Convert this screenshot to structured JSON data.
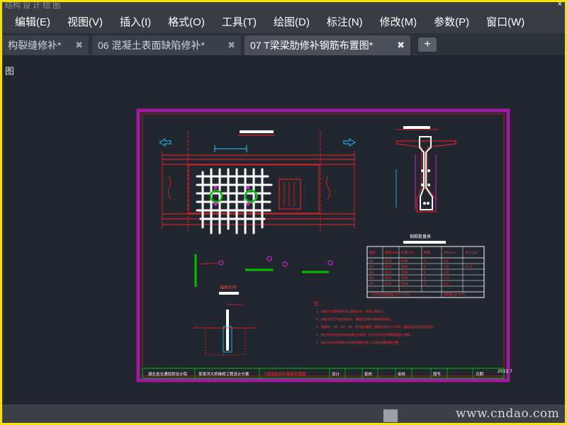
{
  "titlebar": {
    "ghost_text": "结构 设 计 绘 图",
    "close_glyph": "×"
  },
  "menu": [
    "编辑(E)",
    "视图(V)",
    "插入(I)",
    "格式(O)",
    "工具(T)",
    "绘图(D)",
    "标注(N)",
    "修改(M)",
    "参数(P)",
    "窗口(W)"
  ],
  "tabs": [
    {
      "label": "构裂缝修补*",
      "active": false
    },
    {
      "label": "06 混凝土表面缺陷修补*",
      "active": false
    },
    {
      "label": "07 T梁梁肋修补钢筋布置图*",
      "active": true
    }
  ],
  "tab_close_glyph": "✖",
  "add_tab_glyph": "+",
  "view_label": "图",
  "drawing": {
    "detail_title": "锚固大样",
    "table_title": "钢筋数量表",
    "table_headers": [
      "编号",
      "直径(mm)",
      "长度(cm)",
      "根数",
      "共长(m)",
      "合计(kg)"
    ],
    "table_rows": [
      [
        "N1",
        "Φ12",
        "约60",
        "6",
        "3.6",
        ""
      ],
      [
        "N2",
        "Φ12",
        "约60",
        "6",
        "3.6",
        "15.4"
      ],
      [
        "N3",
        "Φ12",
        "约60",
        "6",
        "3.6",
        ""
      ],
      [
        "N4",
        "Φ12",
        "约60",
        "4",
        "2.4",
        ""
      ],
      [
        "N5",
        "Φ12",
        "约60",
        "6",
        "3.6",
        ""
      ]
    ],
    "table_footer_left": "C30补偿收缩混凝土(m³)  0.12",
    "table_footer_right": "植筋胶(kg)  0.15",
    "notes_heading": "注：",
    "notes": [
      "1、本图尺寸除钢筋直径以毫米计外，余均以厘米计。",
      "2、本图适用于T梁梁肋修补，植筋后浇筑补偿收缩混凝土。",
      "3、钢筋N1、N2、N3、N4、N5均为植筋，植筋深度不小于15d，锚固长度满足规范要求。",
      "4、施工前应先凿除松散混凝土并清理，钻孔后采用专用植筋胶植入钢筋。",
      "5、施工中如发现钢筋与原结构钢筋冲突，可适当调整钢筋位置。"
    ],
    "title_block": {
      "unit": "湖北省交通规划设计院",
      "project": "某某河大桥维修工程设计方案",
      "drawing_name": "T梁梁肋修补钢筋布置图",
      "design": "设计",
      "review": "复核",
      "approve": "审核",
      "drawing_no": "图号",
      "date": "日期",
      "year": "2015.7"
    }
  },
  "status": {
    "watermark": "www.cndao.com"
  },
  "colors": {
    "border": "#f4e200",
    "canvas": "#21262f",
    "sheet_border": "#a01aa0",
    "red": "#ff2020",
    "magenta": "#d020d0",
    "green": "#00c000",
    "white": "#ffffff",
    "cyan": "#20c8ff"
  }
}
